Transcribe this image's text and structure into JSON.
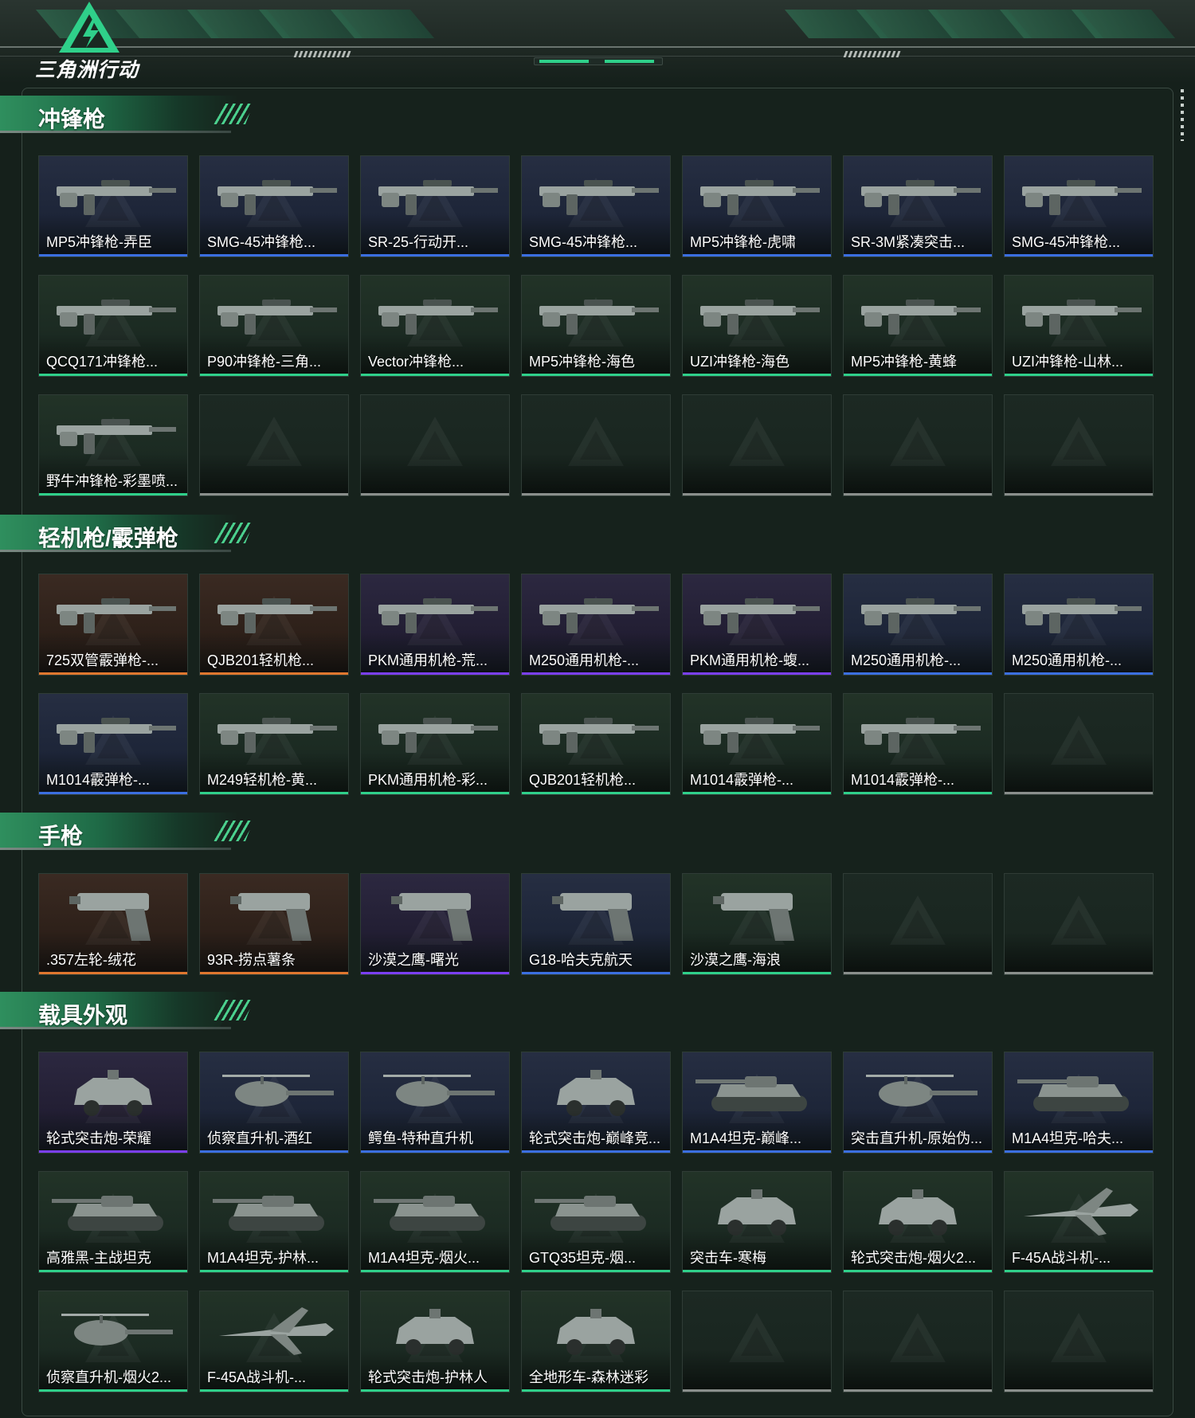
{
  "header": {
    "logo_text": "三角洲行动",
    "logo_icon": "triangle-bolt-icon",
    "accent": "#2fd08a"
  },
  "rarity_colors": {
    "purple": "#7b3ff2",
    "blue": "#3b6fe0",
    "green": "#2fd08a",
    "orange": "#e0772f",
    "empty": "#8a8f8c"
  },
  "sections": [
    {
      "title": "冲锋枪",
      "items": [
        {
          "label": "MP5冲锋枪-弄臣",
          "rarity": "blue",
          "art": "gun"
        },
        {
          "label": "SMG-45冲锋枪...",
          "rarity": "blue",
          "art": "gun"
        },
        {
          "label": "SR-25-行动开...",
          "rarity": "blue",
          "art": "gun"
        },
        {
          "label": "SMG-45冲锋枪...",
          "rarity": "blue",
          "art": "gun"
        },
        {
          "label": "MP5冲锋枪-虎啸",
          "rarity": "blue",
          "art": "gun"
        },
        {
          "label": "SR-3M紧凑突击...",
          "rarity": "blue",
          "art": "gun"
        },
        {
          "label": "SMG-45冲锋枪...",
          "rarity": "blue",
          "art": "gun"
        },
        {
          "label": "QCQ171冲锋枪...",
          "rarity": "green",
          "art": "gun"
        },
        {
          "label": "P90冲锋枪-三角...",
          "rarity": "green",
          "art": "gun"
        },
        {
          "label": "Vector冲锋枪...",
          "rarity": "green",
          "art": "gun"
        },
        {
          "label": "MP5冲锋枪-海色",
          "rarity": "green",
          "art": "gun"
        },
        {
          "label": "UZI冲锋枪-海色",
          "rarity": "green",
          "art": "gun"
        },
        {
          "label": "MP5冲锋枪-黄蜂",
          "rarity": "green",
          "art": "gun"
        },
        {
          "label": "UZI冲锋枪-山林...",
          "rarity": "green",
          "art": "gun"
        },
        {
          "label": "野牛冲锋枪-彩墨喷...",
          "rarity": "green",
          "art": "gun"
        },
        {
          "label": "",
          "rarity": "empty"
        },
        {
          "label": "",
          "rarity": "empty"
        },
        {
          "label": "",
          "rarity": "empty"
        },
        {
          "label": "",
          "rarity": "empty"
        },
        {
          "label": "",
          "rarity": "empty"
        },
        {
          "label": "",
          "rarity": "empty"
        }
      ]
    },
    {
      "title": "轻机枪/霰弹枪",
      "items": [
        {
          "label": "725双管霰弹枪-...",
          "rarity": "orange",
          "art": "gun"
        },
        {
          "label": "QJB201轻机枪...",
          "rarity": "orange",
          "art": "gun"
        },
        {
          "label": "PKM通用机枪-荒...",
          "rarity": "purple",
          "art": "gun"
        },
        {
          "label": "M250通用机枪-...",
          "rarity": "purple",
          "art": "gun"
        },
        {
          "label": "PKM通用机枪-蝮...",
          "rarity": "purple",
          "art": "gun"
        },
        {
          "label": "M250通用机枪-...",
          "rarity": "blue",
          "art": "gun"
        },
        {
          "label": "M250通用机枪-...",
          "rarity": "blue",
          "art": "gun"
        },
        {
          "label": "M1014霰弹枪-...",
          "rarity": "blue",
          "art": "gun"
        },
        {
          "label": "M249轻机枪-黄...",
          "rarity": "green",
          "art": "gun"
        },
        {
          "label": "PKM通用机枪-彩...",
          "rarity": "green",
          "art": "gun"
        },
        {
          "label": "QJB201轻机枪...",
          "rarity": "green",
          "art": "gun"
        },
        {
          "label": "M1014霰弹枪-...",
          "rarity": "green",
          "art": "gun"
        },
        {
          "label": "M1014霰弹枪-...",
          "rarity": "green",
          "art": "gun"
        },
        {
          "label": "",
          "rarity": "empty"
        }
      ]
    },
    {
      "title": "手枪",
      "items": [
        {
          "label": ".357左轮-绒花",
          "rarity": "orange",
          "art": "pistol"
        },
        {
          "label": "93R-捞点薯条",
          "rarity": "orange",
          "art": "pistol"
        },
        {
          "label": "沙漠之鹰-曙光",
          "rarity": "purple",
          "art": "pistol"
        },
        {
          "label": "G18-哈夫克航天",
          "rarity": "blue",
          "art": "pistol"
        },
        {
          "label": "沙漠之鹰-海浪",
          "rarity": "green",
          "art": "pistol"
        },
        {
          "label": "",
          "rarity": "empty"
        },
        {
          "label": "",
          "rarity": "empty"
        }
      ]
    },
    {
      "title": "载具外观",
      "items": [
        {
          "label": "轮式突击炮-荣耀",
          "rarity": "purple",
          "art": "vehicle"
        },
        {
          "label": "侦察直升机-酒红",
          "rarity": "blue",
          "art": "heli"
        },
        {
          "label": "鳄鱼-特种直升机",
          "rarity": "blue",
          "art": "heli"
        },
        {
          "label": "轮式突击炮-巅峰竞...",
          "rarity": "blue",
          "art": "vehicle"
        },
        {
          "label": "M1A4坦克-巅峰...",
          "rarity": "blue",
          "art": "tank"
        },
        {
          "label": "突击直升机-原始伪...",
          "rarity": "blue",
          "art": "heli"
        },
        {
          "label": "M1A4坦克-哈夫...",
          "rarity": "blue",
          "art": "tank"
        },
        {
          "label": "高雅黑-主战坦克",
          "rarity": "green",
          "art": "tank"
        },
        {
          "label": "M1A4坦克-护林...",
          "rarity": "green",
          "art": "tank"
        },
        {
          "label": "M1A4坦克-烟火...",
          "rarity": "green",
          "art": "tank"
        },
        {
          "label": "GTQ35坦克-烟...",
          "rarity": "green",
          "art": "tank"
        },
        {
          "label": "突击车-寒梅",
          "rarity": "green",
          "art": "vehicle"
        },
        {
          "label": "轮式突击炮-烟火2...",
          "rarity": "green",
          "art": "vehicle"
        },
        {
          "label": "F-45A战斗机-...",
          "rarity": "green",
          "art": "jet"
        },
        {
          "label": "侦察直升机-烟火2...",
          "rarity": "green",
          "art": "heli"
        },
        {
          "label": "F-45A战斗机-...",
          "rarity": "green",
          "art": "jet"
        },
        {
          "label": "轮式突击炮-护林人",
          "rarity": "green",
          "art": "vehicle"
        },
        {
          "label": "全地形车-森林迷彩",
          "rarity": "green",
          "art": "vehicle"
        },
        {
          "label": "",
          "rarity": "empty"
        },
        {
          "label": "",
          "rarity": "empty"
        },
        {
          "label": "",
          "rarity": "empty"
        }
      ]
    }
  ]
}
